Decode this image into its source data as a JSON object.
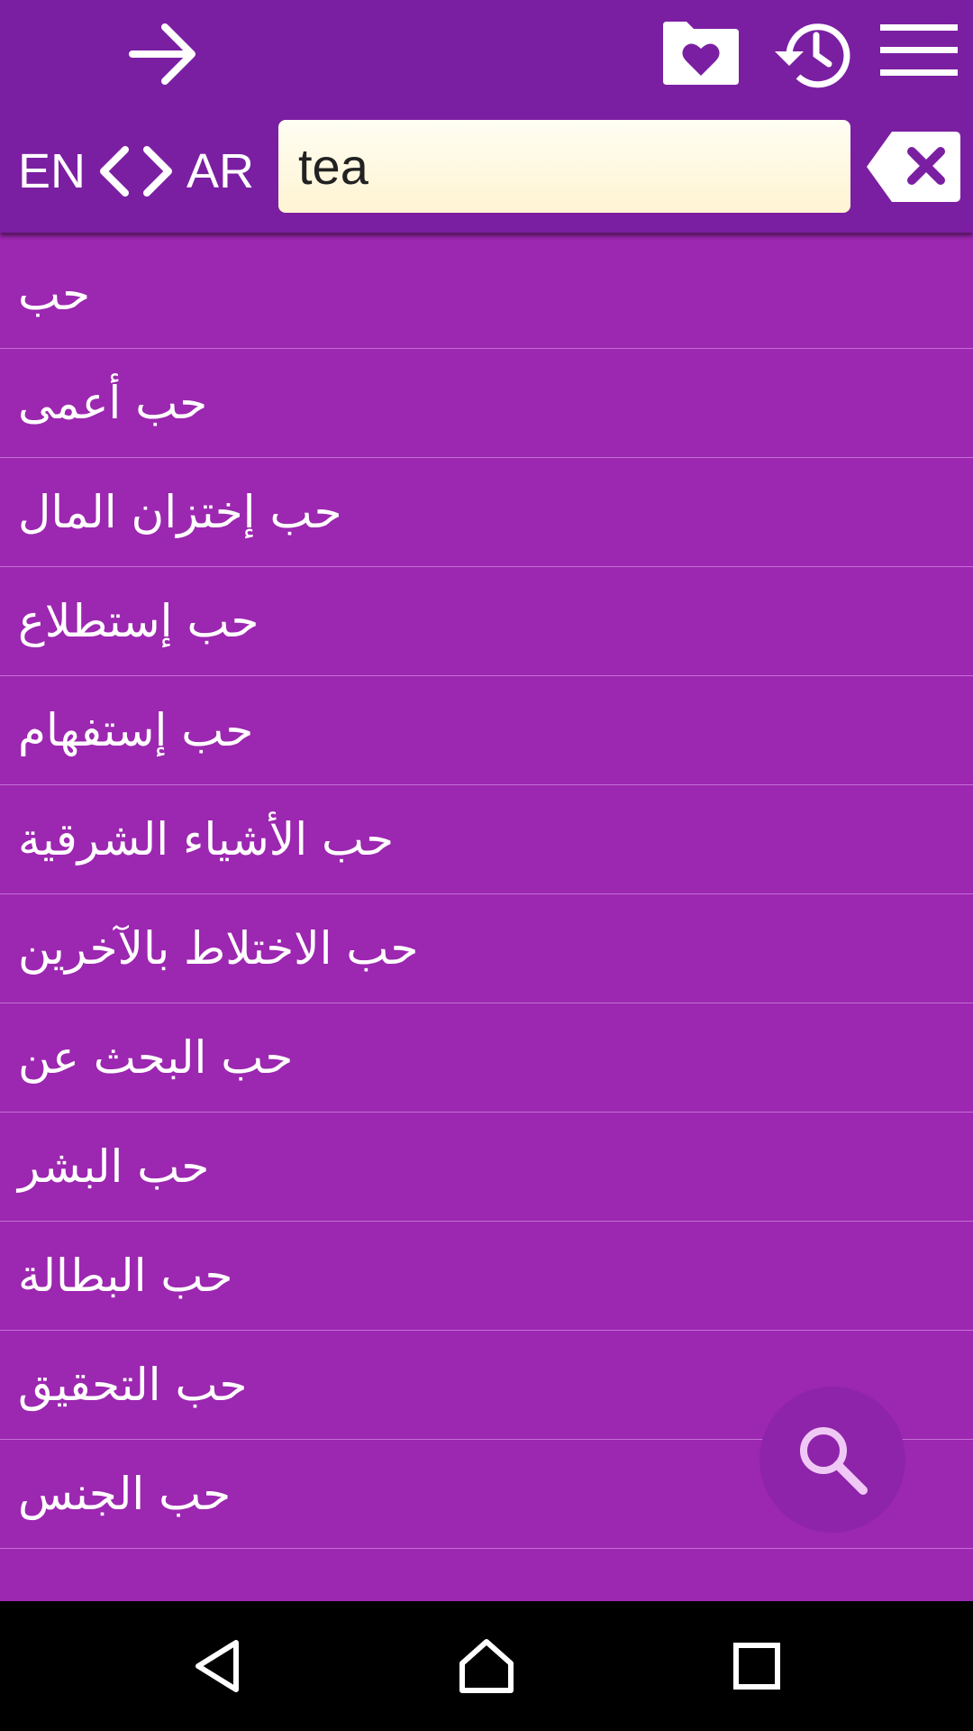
{
  "toolbar": {
    "back_icon": "arrow-right-icon",
    "favorites_icon": "heart-folder-icon",
    "history_icon": "history-clock-icon",
    "menu_icon": "hamburger-menu-icon"
  },
  "language": {
    "from": "EN",
    "to": "AR",
    "swap_icon": "chevron-left-right-icon"
  },
  "search": {
    "value": "tea",
    "clear_icon": "backspace-clear-icon"
  },
  "results": [
    "حب",
    "حب أعمى",
    "حب إختزان المال",
    "حب إستطلاع",
    "حب إستفهام",
    "حب الأشياء الشرقية",
    "حب الاختلاط بالآخرين",
    "حب البحث عن",
    "حب البشر",
    "حب البطالة",
    "حب التحقيق",
    "حب الجنس"
  ],
  "fab": {
    "icon": "search-icon"
  },
  "navbar": {
    "back_icon": "nav-back-icon",
    "home_icon": "nav-home-icon",
    "recent_icon": "nav-recent-icon"
  },
  "colors": {
    "toolbar": "#7b1fa2",
    "list_background": "#9c27b0",
    "divider": "#c46fd6",
    "fab": "#8e24aa",
    "input_background": "#fff7dc"
  }
}
